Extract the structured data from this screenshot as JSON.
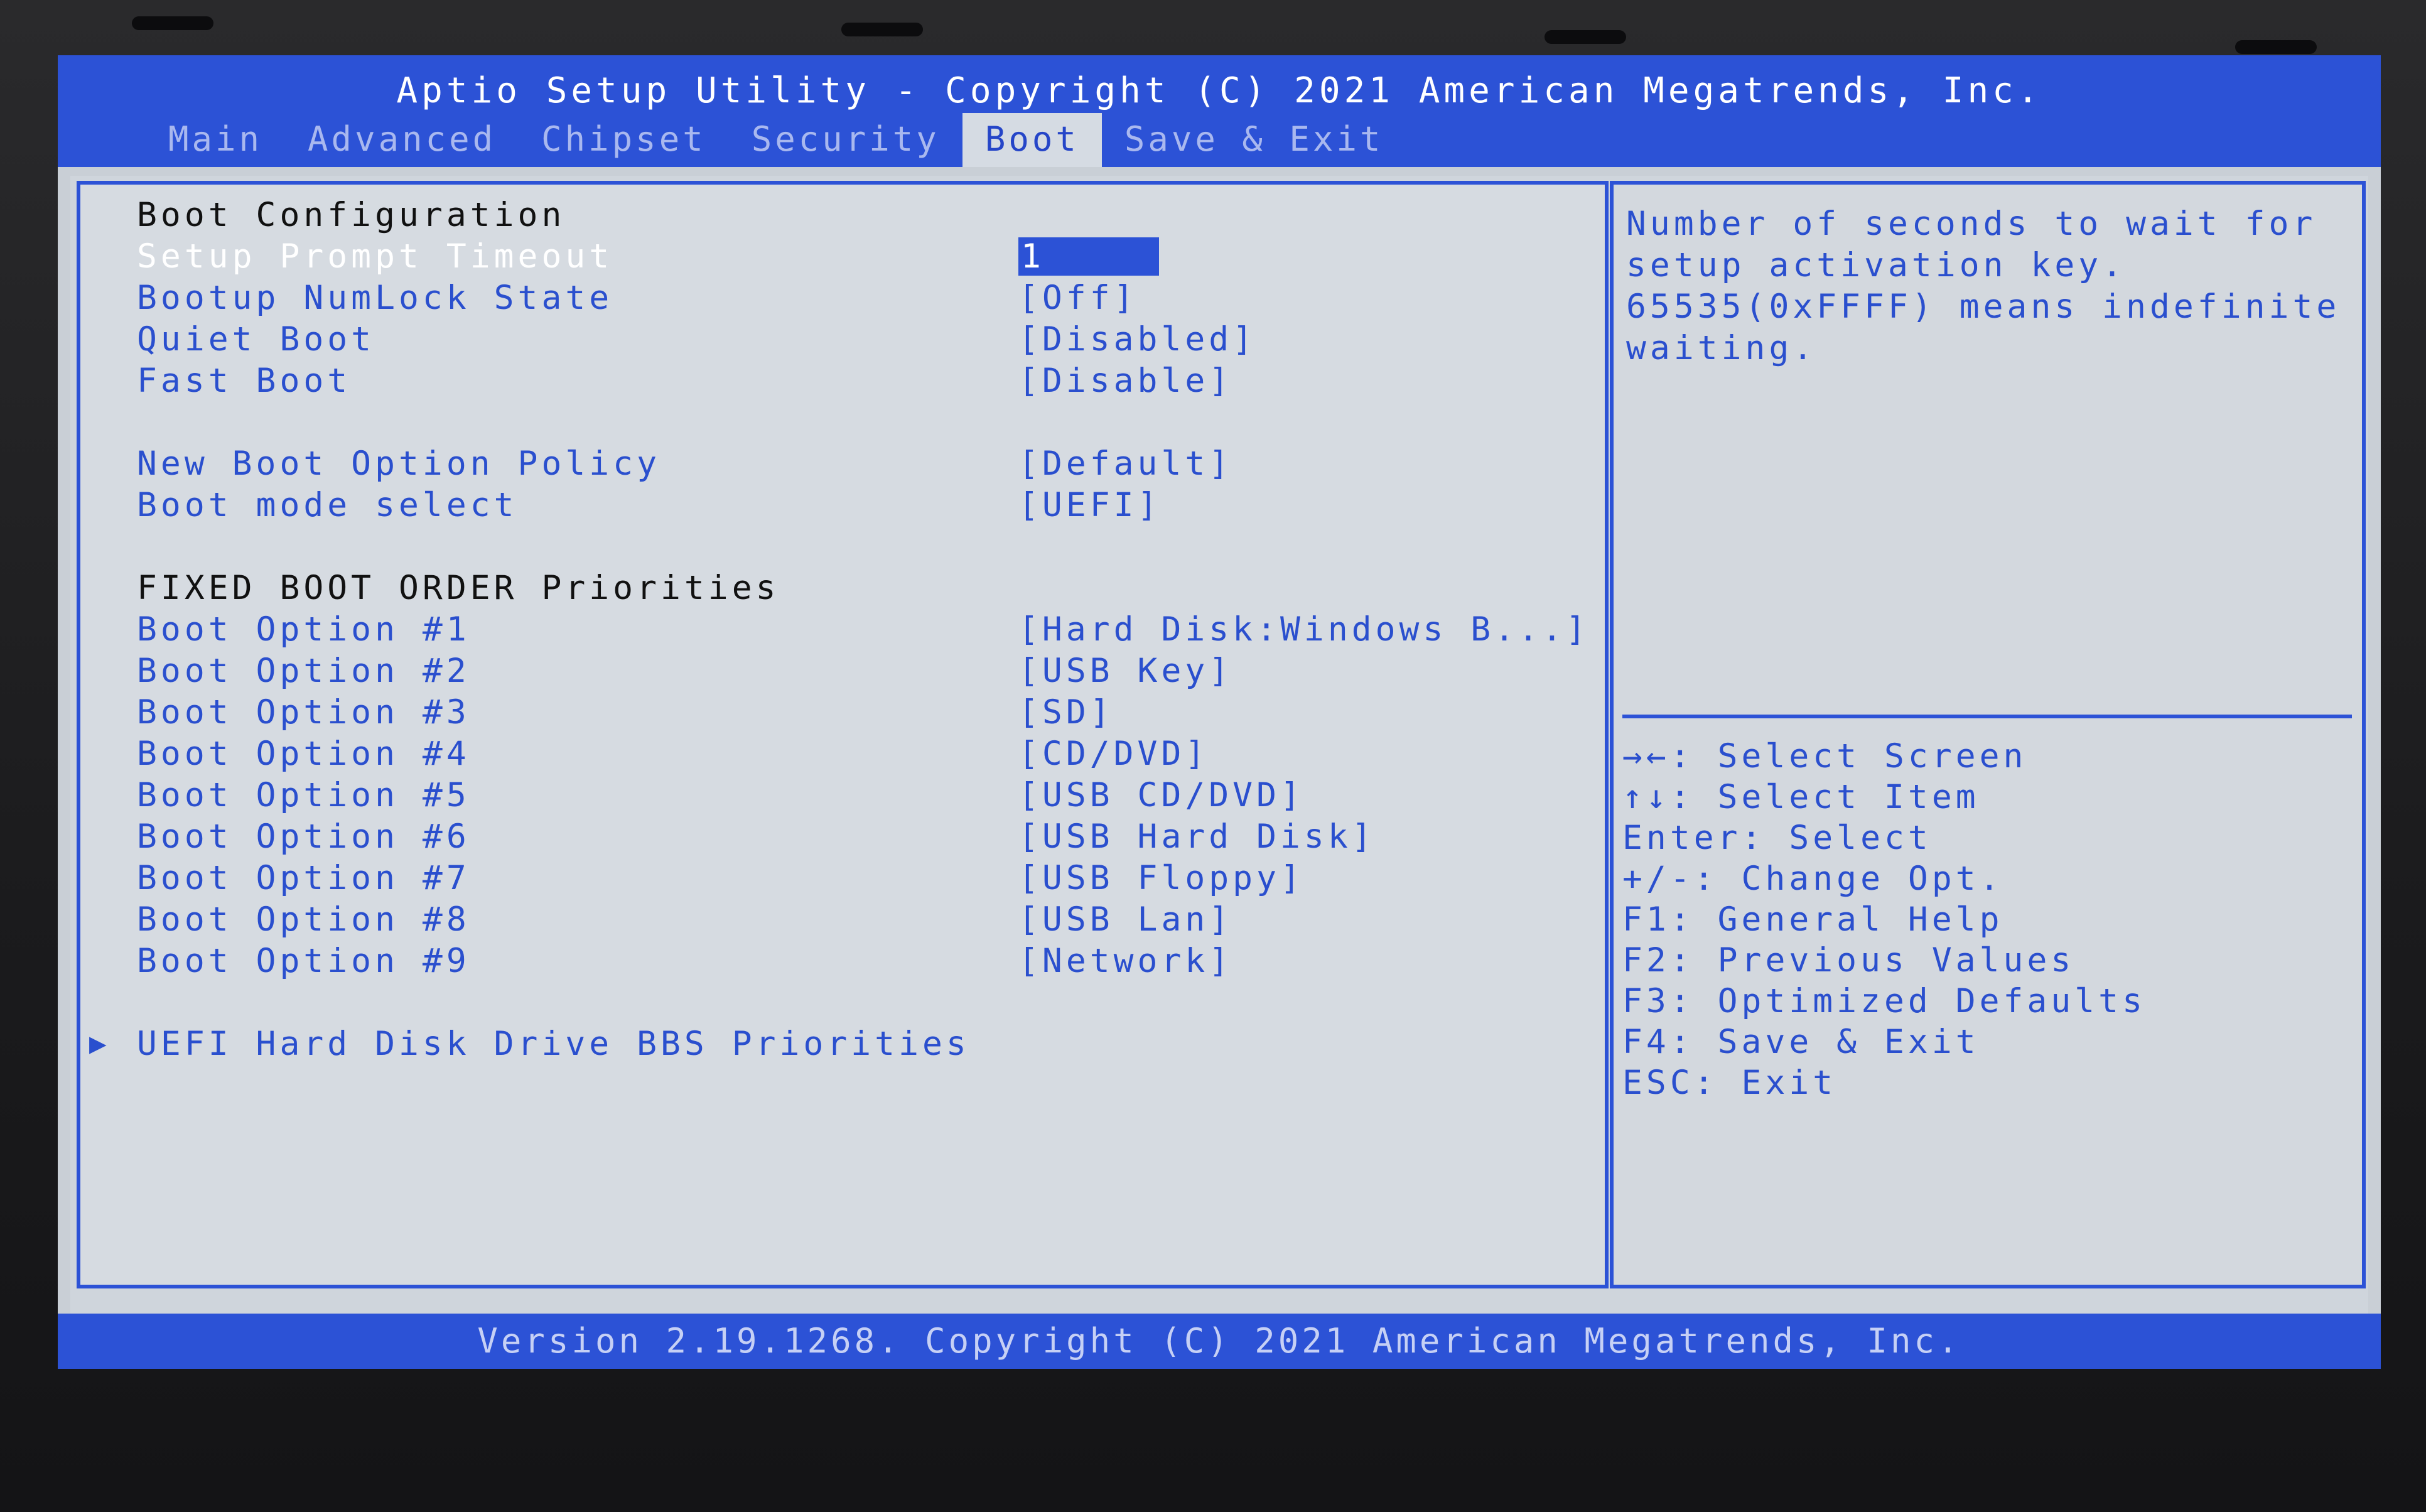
{
  "header": {
    "title": "Aptio Setup Utility - Copyright (C) 2021 American Megatrends, Inc.",
    "tabs": [
      {
        "label": "Main"
      },
      {
        "label": "Advanced"
      },
      {
        "label": "Chipset"
      },
      {
        "label": "Security"
      },
      {
        "label": "Boot"
      },
      {
        "label": "Save & Exit"
      }
    ],
    "active_tab": "Boot"
  },
  "boot": {
    "section_config": "Boot Configuration",
    "settings": [
      {
        "label": "Setup Prompt Timeout",
        "value": "1"
      },
      {
        "label": "Bootup NumLock State",
        "value": "[Off]"
      },
      {
        "label": "Quiet Boot",
        "value": "[Disabled]"
      },
      {
        "label": "Fast Boot",
        "value": "[Disable]"
      },
      {
        "label": "New Boot Option Policy",
        "value": "[Default]"
      },
      {
        "label": "Boot mode select",
        "value": "[UEFI]"
      }
    ],
    "section_fixed": "FIXED BOOT ORDER Priorities",
    "options": [
      {
        "label": "Boot Option #1",
        "value": "[Hard Disk:Windows B...]"
      },
      {
        "label": "Boot Option #2",
        "value": "[USB Key]"
      },
      {
        "label": "Boot Option #3",
        "value": "[SD]"
      },
      {
        "label": "Boot Option #4",
        "value": "[CD/DVD]"
      },
      {
        "label": "Boot Option #5",
        "value": "[USB CD/DVD]"
      },
      {
        "label": "Boot Option #6",
        "value": "[USB Hard Disk]"
      },
      {
        "label": "Boot Option #7",
        "value": "[USB Floppy]"
      },
      {
        "label": "Boot Option #8",
        "value": "[USB Lan]"
      },
      {
        "label": "Boot Option #9",
        "value": "[Network]"
      }
    ],
    "submenu": {
      "arrow": "▶",
      "label": "UEFI Hard Disk Drive BBS Priorities"
    }
  },
  "help": {
    "text": "Number of seconds to wait for setup activation key. 65535(0xFFFF) means indefinite waiting.",
    "keys": [
      "→←: Select Screen",
      "↑↓: Select Item",
      "Enter: Select",
      "+/-: Change Opt.",
      "F1: General Help",
      "F2: Previous Values",
      "F3: Optimized Defaults",
      "F4: Save & Exit",
      "ESC: Exit"
    ]
  },
  "footer": {
    "text": "Version 2.19.1268. Copyright (C) 2021 American Megatrends, Inc."
  },
  "colors": {
    "bios_blue": "#2c52d6",
    "panel_bg": "#d6dbe1",
    "setting_text": "#2a4fce",
    "heading_text": "#111111"
  }
}
